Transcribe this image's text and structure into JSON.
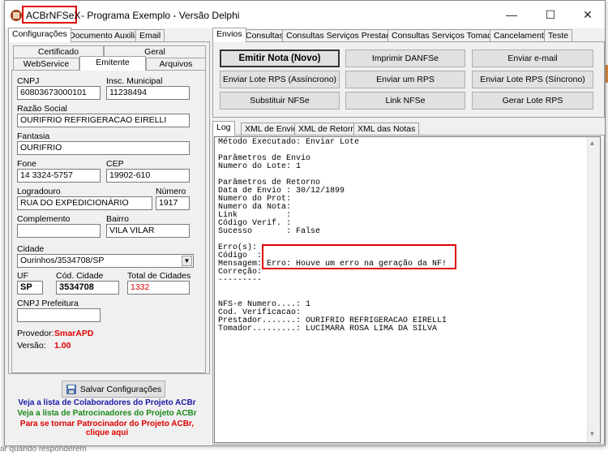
{
  "window": {
    "app_name": "ACBrNFSeX",
    "title_rest": " - Programa Exemplo - Versão Delphi",
    "minimize": "—",
    "maximize": "☐",
    "close": "✕"
  },
  "background": {
    "status_text": "ar quando responderem"
  },
  "left": {
    "tabs": [
      "Configurações",
      "Documento Auxiliar",
      "Email"
    ],
    "subtabs_row1": [
      "Certificado",
      "Geral"
    ],
    "subtabs_row2": [
      "WebService",
      "Emitente",
      "Arquivos"
    ],
    "form": {
      "cnpj_label": "CNPJ",
      "cnpj": "60803673000101",
      "im_label": "Insc. Municipal",
      "im": "11238494",
      "razao_label": "Razão Social",
      "razao": "OURIFRIO REFRIGERACAO EIRELLI",
      "fantasia_label": "Fantasia",
      "fantasia": "OURIFRIO",
      "fone_label": "Fone",
      "fone": "14 3324-5757",
      "cep_label": "CEP",
      "cep": "19902-610",
      "logradouro_label": "Logradouro",
      "logradouro": "RUA DO EXPEDICIONÁRIO",
      "numero_label": "Número",
      "numero": "1917",
      "complemento_label": "Complemento",
      "complemento": "",
      "bairro_label": "Bairro",
      "bairro": "VILA VILAR",
      "cidade_label": "Cidade",
      "cidade": "Ourinhos/3534708/SP",
      "uf_label": "UF",
      "uf": "SP",
      "cod_cidade_label": "Cód. Cidade",
      "cod_cidade": "3534708",
      "total_cidades_label": "Total de Cidades",
      "total_cidades": "1332",
      "cnpj_pref_label": "CNPJ Prefeitura",
      "cnpj_pref": "",
      "provedor_label": "Provedor:",
      "provedor": "SmarAPD",
      "versao_label": "Versão:",
      "versao": "1.00"
    },
    "save_button": "Salvar Configurações",
    "links": [
      {
        "text": "Veja a lista de Colaboradores do Projeto ACBr",
        "color": "#1a1aa8"
      },
      {
        "text": "Veja a lista de Patrocinadores do Projeto ACBr",
        "color": "#1a8a1a"
      },
      {
        "text": "Para se tornar Patrocinador do Projeto ACBr,",
        "color": "#e00000"
      },
      {
        "text": "clique aqui",
        "color": "#e00000"
      }
    ]
  },
  "right": {
    "tabs": [
      "Envios",
      "Consultas",
      "Consultas Serviços Prestados",
      "Consultas Serviços Tomados",
      "Cancelamento",
      "Teste"
    ],
    "buttons": [
      [
        "Emitir Nota (Novo)",
        "Imprimir DANFSe",
        "Enviar e-mail"
      ],
      [
        "Enviar Lote RPS (Assíncrono)",
        "Enviar um RPS",
        "Enviar Lote RPS (Síncrono)"
      ],
      [
        "Substituir NFSe",
        "Link NFSe",
        "Gerar Lote RPS"
      ]
    ],
    "log_tabs": [
      "Log",
      "XML de Envio",
      "XML de Retorno",
      "XML das Notas"
    ],
    "log_lines": [
      "Método Executado: Enviar Lote",
      "",
      "Parâmetros de Envio",
      "Numero do Lote: 1",
      "",
      "Parâmetros de Retorno",
      "Data de Envio : 30/12/1899",
      "Numero do Prot:",
      "Numero da Nota:",
      "Link          :",
      "Código Verif. :",
      "Sucesso       : False",
      "",
      "Erro(s):",
      "Código  :",
      "Mensagem: Erro: Houve um erro na geração da NF!",
      "Correção:",
      "---------",
      "",
      "",
      "NFS-e Numero....: 1",
      "Cod. Verificacao:",
      "Prestador.......: OURIFRIO REFRIGERACAO EIRELLI",
      "Tomador.........: LUCIMARA ROSA LIMA DA SILVA"
    ]
  }
}
